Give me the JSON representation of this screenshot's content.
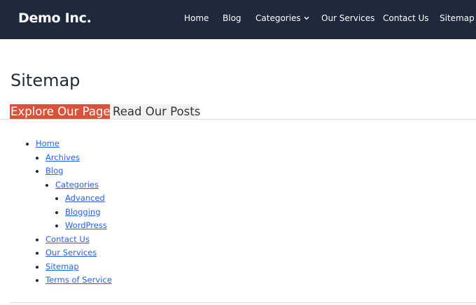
{
  "header": {
    "brand": "Demo Inc.",
    "nav": [
      {
        "label": "Home"
      },
      {
        "label": "Blog"
      },
      {
        "label": "Categories",
        "icon": "chevron-down-icon"
      },
      {
        "label": "Our Services"
      },
      {
        "label": "Contact Us"
      },
      {
        "label": "Sitemap"
      }
    ]
  },
  "main": {
    "title": "Sitemap",
    "tabs": [
      {
        "label": "Explore Our Pages",
        "active": true
      },
      {
        "label": "Read Our Posts",
        "active": false
      }
    ],
    "sitemap": {
      "home": "Home",
      "archives": "Archives",
      "blog": "Blog",
      "categories": "Categories",
      "advanced": "Advanced",
      "blogging": "Blogging",
      "wordpress": "WordPress",
      "contact": "Contact Us",
      "services": "Our Services",
      "sitemap": "Sitemap",
      "terms": "Terms of Service"
    }
  },
  "colors": {
    "header_bg": "#1e293b",
    "tab_active_bg": "#d9533a",
    "link": "#2563eb"
  }
}
